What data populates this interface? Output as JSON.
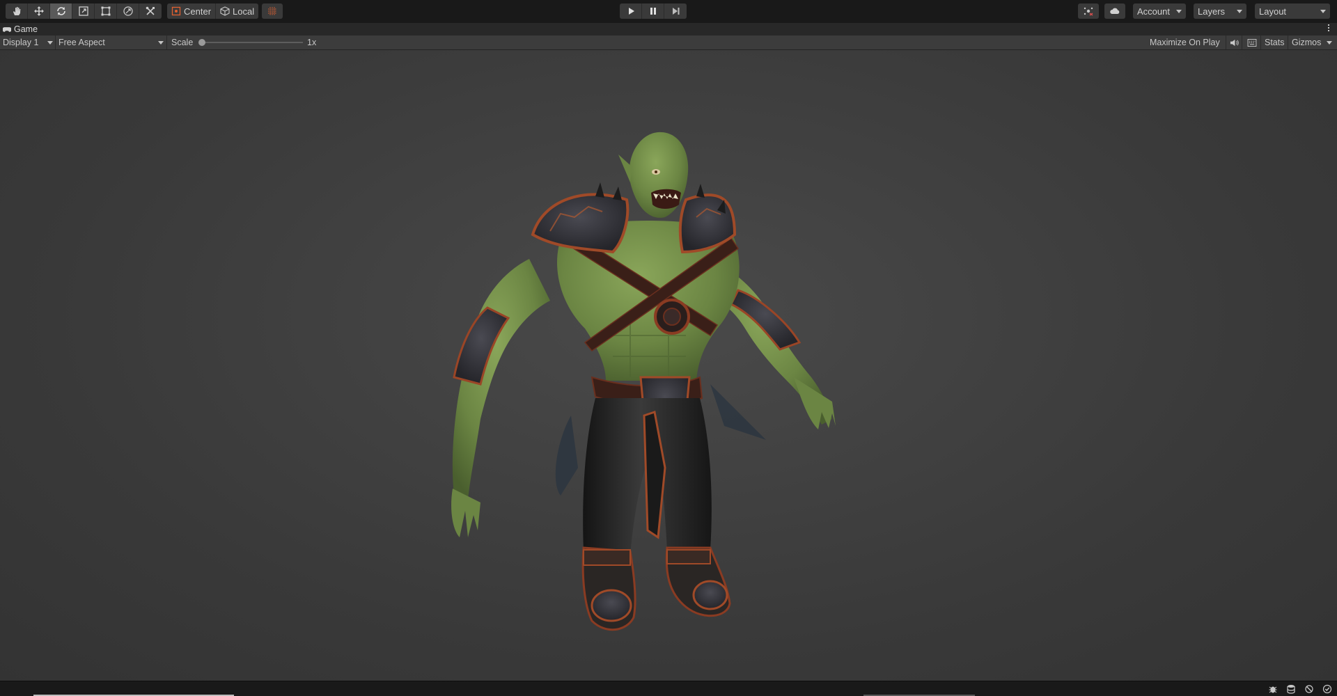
{
  "toolbar": {
    "tools": [
      {
        "icon": "hand-icon",
        "active": false
      },
      {
        "icon": "move-icon",
        "active": false
      },
      {
        "icon": "rotate-icon",
        "active": true
      },
      {
        "icon": "scale-icon",
        "active": false
      },
      {
        "icon": "rect-icon",
        "active": false
      },
      {
        "icon": "transform-icon",
        "active": false
      },
      {
        "icon": "custom-tool-icon",
        "active": false
      }
    ],
    "pivot_label": "Center",
    "space_label": "Local",
    "account_label": "Account",
    "layers_label": "Layers",
    "layout_label": "Layout"
  },
  "tab": {
    "label": "Game"
  },
  "game_toolbar": {
    "display_label": "Display 1",
    "aspect_label": "Free Aspect",
    "scale_label": "Scale",
    "scale_value": "1x",
    "scale_slider_level": 0,
    "maximize_label": "Maximize On Play",
    "stats_label": "Stats",
    "gizmos_label": "Gizmos"
  },
  "colors": {
    "toolbar_bg": "#191919",
    "panel_bg": "#3c3c3c",
    "viewport_bg": "#424242",
    "active_tool_bg": "#5a5a5a",
    "accent_orange": "#e06030",
    "skin_green": "#6f8a45",
    "armor_rust": "#8a3b22"
  }
}
